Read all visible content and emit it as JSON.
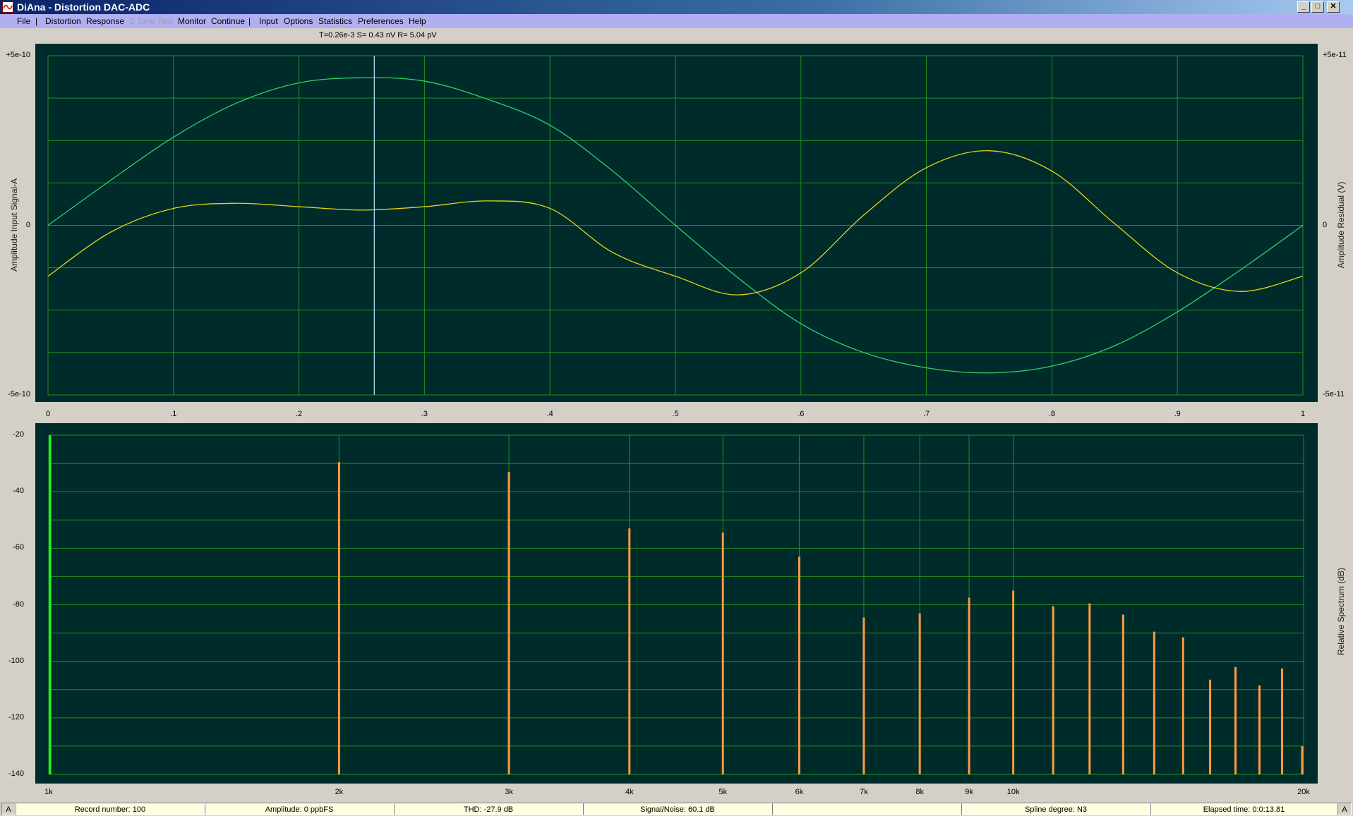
{
  "window": {
    "title": "DiAna - Distortion DAC-ADC",
    "controls": {
      "minimize": "_",
      "maximize": "□",
      "close": "✕"
    }
  },
  "menu": {
    "items": [
      {
        "label": "File",
        "enabled": true
      },
      {
        "label": "Distortion",
        "enabled": true
      },
      {
        "label": "Response",
        "enabled": true
      },
      {
        "label": "2 Tone Test",
        "enabled": false
      },
      {
        "label": "Monitor",
        "enabled": true
      },
      {
        "label": "Continue",
        "enabled": true
      },
      {
        "label": "Input",
        "enabled": true
      },
      {
        "label": "Options",
        "enabled": true
      },
      {
        "label": "Statistics",
        "enabled": true
      },
      {
        "label": "Preferences",
        "enabled": true
      },
      {
        "label": "Help",
        "enabled": true
      }
    ],
    "separator": "|"
  },
  "cursor_readout": "T=0.26e-3 S= 0.43 nV R= 5.04 pV",
  "colors": {
    "plot_bg": "#002b2b",
    "grid": "#1f8f1f",
    "signal": "#2fd16a",
    "residual": "#e6d21a",
    "cursor": "#bfe6ff",
    "bar": "#ff9b3f",
    "fundamental": "#22ff22"
  },
  "chart_data": [
    {
      "type": "line",
      "xlabel": "",
      "ylabel": "Amplitude Input Signal-A",
      "ylabel_right": "Amplitude Residual (V)",
      "xlim": [
        0,
        1
      ],
      "ylim_left": [
        -5e-10,
        5e-10
      ],
      "ylim_right": [
        -5e-11,
        5e-11
      ],
      "x_ticks": [
        "0",
        ".1",
        ".2",
        ".3",
        ".4",
        ".5",
        ".6",
        ".7",
        ".8",
        ".9",
        "1"
      ],
      "y_ticks_left": [
        "+5e-10",
        "0",
        "-5e-10"
      ],
      "y_ticks_right": [
        "+5e-11",
        "0",
        "-5e-11"
      ],
      "cursor_x": 0.26,
      "grid": true,
      "series": [
        {
          "axis": "left",
          "x": [
            0,
            0.05,
            0.1,
            0.15,
            0.2,
            0.25,
            0.3,
            0.35,
            0.4,
            0.45,
            0.5,
            0.55,
            0.6,
            0.65,
            0.7,
            0.75,
            0.8,
            0.85,
            0.9,
            0.95,
            1.0
          ],
          "y": [
            0,
            1.33e-10,
            2.6e-10,
            3.6e-10,
            4.2e-10,
            4.35e-10,
            4.25e-10,
            3.72e-10,
            2.95e-10,
            1.6e-10,
            0,
            -1.55e-10,
            -2.9e-10,
            -3.75e-10,
            -4.2e-10,
            -4.35e-10,
            -4.15e-10,
            -3.55e-10,
            -2.55e-10,
            -1.32e-10,
            0
          ]
        },
        {
          "axis": "right",
          "x": [
            0,
            0.05,
            0.1,
            0.15,
            0.2,
            0.25,
            0.3,
            0.35,
            0.4,
            0.45,
            0.5,
            0.55,
            0.6,
            0.65,
            0.7,
            0.75,
            0.8,
            0.85,
            0.9,
            0.95,
            1.0
          ],
          "y": [
            -1.5e-11,
            -2e-12,
            5e-12,
            6.5e-12,
            5.5e-12,
            4.5e-12,
            5.5e-12,
            7.2e-12,
            5e-12,
            -8e-12,
            -1.5e-11,
            -2.05e-11,
            -1.4e-11,
            3e-12,
            1.7e-11,
            2.2e-11,
            1.6e-11,
            5e-13,
            -1.4e-11,
            -1.95e-11,
            -1.5e-11
          ]
        }
      ]
    },
    {
      "type": "bar",
      "ylabel": "Relative Spectrum (dB)",
      "x_scale": "log",
      "xlim": [
        1000,
        20000
      ],
      "ylim": [
        -140,
        -20
      ],
      "x_ticks": [
        {
          "label": "1k",
          "value": 1000
        },
        {
          "label": "2k",
          "value": 2000
        },
        {
          "label": "3k",
          "value": 3000
        },
        {
          "label": "4k",
          "value": 4000
        },
        {
          "label": "5k",
          "value": 5000
        },
        {
          "label": "6k",
          "value": 6000
        },
        {
          "label": "7k",
          "value": 7000
        },
        {
          "label": "8k",
          "value": 8000
        },
        {
          "label": "9k",
          "value": 9000
        },
        {
          "label": "10k",
          "value": 10000
        },
        {
          "label": "20k",
          "value": 20000
        }
      ],
      "y_ticks": [
        "-20",
        "-40",
        "-60",
        "-80",
        "-100",
        "-120",
        "-140"
      ],
      "grid": true,
      "fundamental": {
        "x": 1000,
        "y": -20
      },
      "bars": [
        {
          "x": 2000,
          "y": -29.5
        },
        {
          "x": 3000,
          "y": -33
        },
        {
          "x": 4000,
          "y": -53
        },
        {
          "x": 5000,
          "y": -54.5
        },
        {
          "x": 6000,
          "y": -63
        },
        {
          "x": 7000,
          "y": -84.5
        },
        {
          "x": 8000,
          "y": -83
        },
        {
          "x": 9000,
          "y": -77.5
        },
        {
          "x": 10000,
          "y": -75
        },
        {
          "x": 11000,
          "y": -80.5
        },
        {
          "x": 12000,
          "y": -79.5
        },
        {
          "x": 13000,
          "y": -83.5
        },
        {
          "x": 14000,
          "y": -89.5
        },
        {
          "x": 15000,
          "y": -91.5
        },
        {
          "x": 16000,
          "y": -106.5
        },
        {
          "x": 17000,
          "y": -102
        },
        {
          "x": 18000,
          "y": -108.5
        },
        {
          "x": 19000,
          "y": -102.5
        },
        {
          "x": 20000,
          "y": -130
        }
      ]
    }
  ],
  "status": {
    "left_tag": "A",
    "record": "Record number: 100",
    "amplitude": "Amplitude: 0 ppbFS",
    "thd": "THD:  -27.9 dB",
    "sn": "Signal/Noise:   60.1 dB",
    "empty": "",
    "spline": "Spline degree: N3",
    "elapsed": "Elapsed time: 0:0:13.81",
    "right_tag": "A"
  }
}
